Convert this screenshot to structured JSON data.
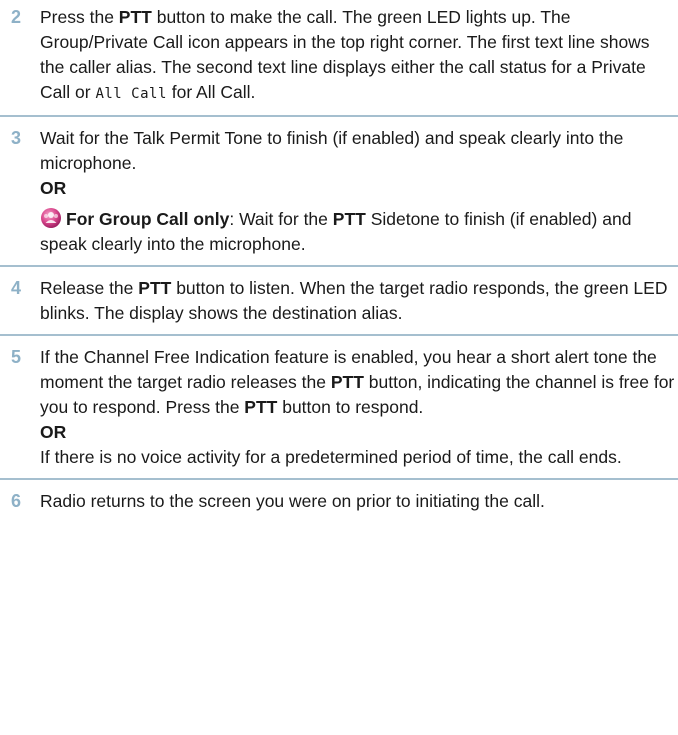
{
  "steps": [
    {
      "number": "2",
      "parts": {
        "a": "Press the ",
        "b": "PTT",
        "c": " button to make the call. The green LED lights up. The Group/Private Call icon appears in the top right corner. The first text line shows the caller alias. The second text line displays either the call status for a Private Call or ",
        "d": "All Call",
        "e": " for All Call."
      }
    },
    {
      "number": "3",
      "line1": "Wait for the Talk Permit Tone to finish (if enabled) and speak clearly into the microphone.",
      "or": "OR",
      "group_label": "For Group Call only",
      "g1": ": Wait for the ",
      "g2": "PTT",
      "g3": " Sidetone to finish (if enabled) and speak clearly into the microphone.",
      "icon": "group-call-icon"
    },
    {
      "number": "4",
      "a": "Release the ",
      "b": "PTT",
      "c": " button to listen. When the target radio responds, the green LED blinks. The display shows the destination alias."
    },
    {
      "number": "5",
      "a": "If the Channel Free Indication feature is enabled, you hear a short alert tone the moment the target radio releases the ",
      "b": "PTT",
      "c": " button, indicating the channel is free for you to respond. Press the ",
      "d": "PTT",
      "e": " button to respond.",
      "or": "OR",
      "f": "If there is no voice activity for a predetermined period of time, the call ends."
    },
    {
      "number": "6",
      "a": "Radio returns to the screen you were on prior to initiating the call."
    }
  ],
  "colors": {
    "step_number": "#8eb1c7",
    "divider": "#a5bfcf",
    "icon": "#d9468c"
  }
}
